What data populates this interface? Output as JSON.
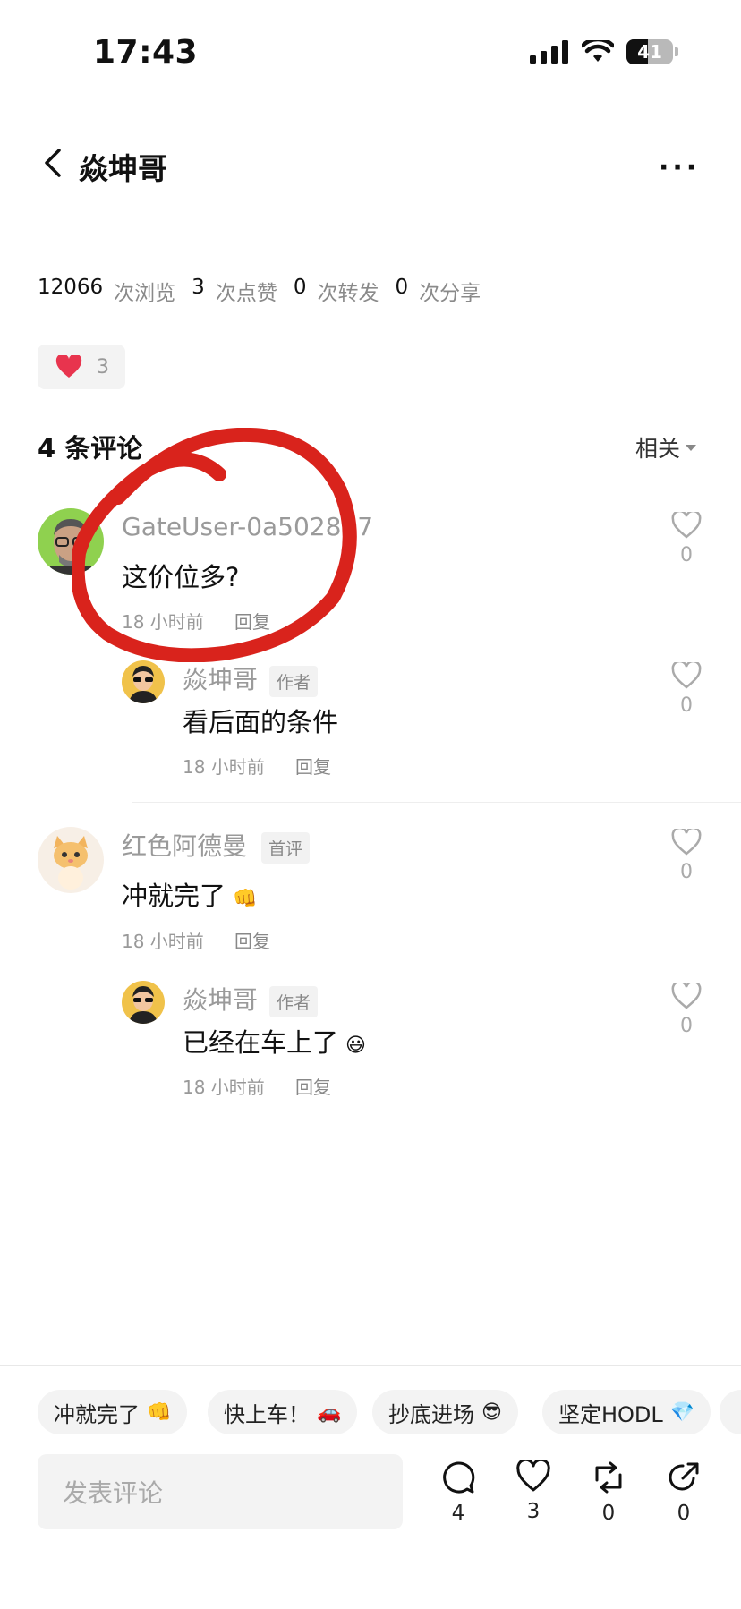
{
  "status_bar": {
    "time": "17:43",
    "battery": "41"
  },
  "header": {
    "title": "焱坤哥",
    "more_label": "···"
  },
  "stats": [
    {
      "value": "12066",
      "label": "次浏览"
    },
    {
      "value": "3",
      "label": "次点赞"
    },
    {
      "value": "0",
      "label": "次转发"
    },
    {
      "value": "0",
      "label": "次分享"
    }
  ],
  "like_pill": {
    "count": "3"
  },
  "comments_header": {
    "title": "4 条评论",
    "sort_label": "相关"
  },
  "comments": [
    {
      "name": "GateUser-0a502887",
      "text": "这价位多?",
      "time": "18 小时前",
      "reply": "回复",
      "likes": "0"
    },
    {
      "name": "焱坤哥",
      "tag": "作者",
      "text": "看后面的条件",
      "time": "18 小时前",
      "reply": "回复",
      "likes": "0"
    },
    {
      "name": "红色阿德曼",
      "tag": "首评",
      "text": "冲就完了",
      "emoji": "👊",
      "time": "18 小时前",
      "reply": "回复",
      "likes": "0"
    },
    {
      "name": "焱坤哥",
      "tag": "作者",
      "text": "已经在车上了",
      "emoji": "😃",
      "time": "18 小时前",
      "reply": "回复",
      "likes": "0"
    }
  ],
  "quick_replies": [
    {
      "text": "冲就完了",
      "emoji": "👊"
    },
    {
      "text": "快上车！",
      "emoji": "🚗"
    },
    {
      "text": "抄底进场",
      "emoji": "😎"
    },
    {
      "text": "坚定HODL",
      "emoji": "💎"
    }
  ],
  "composer": {
    "placeholder": "发表评论"
  },
  "actions": {
    "comments": "4",
    "likes": "3",
    "reposts": "0",
    "shares": "0"
  },
  "colors": {
    "heart": "#e8344e",
    "annotation": "#d9231c",
    "muted": "#999999"
  }
}
